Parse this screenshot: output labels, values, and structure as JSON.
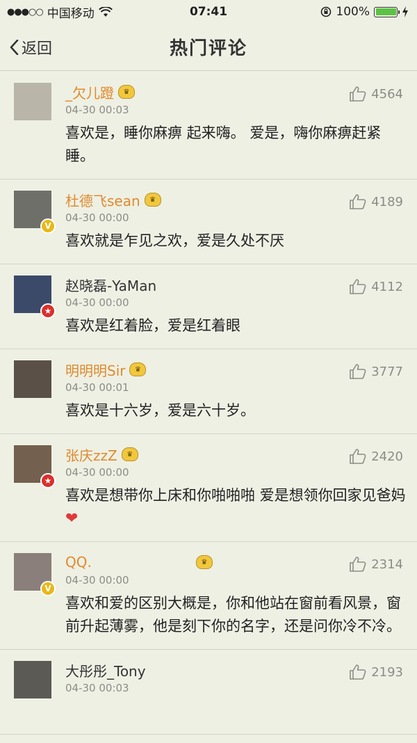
{
  "status_bar": {
    "carrier": "中国移动",
    "time": "07:41",
    "battery_percent": "100%",
    "battery_level": 1.0
  },
  "nav": {
    "back_label": "返回",
    "title": "热门评论"
  },
  "comments": [
    {
      "username": "_欠儿蹬",
      "time": "04-30 00:03",
      "text": "喜欢是，睡你麻痹 起来嗨。 爱是，嗨你麻痹赶紧睡。",
      "likes": "4564",
      "vip": true,
      "badge": ""
    },
    {
      "username": "杜德飞sean",
      "time": "04-30 00:00",
      "text": "喜欢就是乍见之欢，爱是久处不厌",
      "likes": "4189",
      "vip": true,
      "badge": "v"
    },
    {
      "username": "赵晓磊-YaMan",
      "time": "04-30 00:00",
      "text": "喜欢是红着脸，爱是红着眼",
      "likes": "4112",
      "vip": false,
      "badge": "star"
    },
    {
      "username": "明明明Sir",
      "time": "04-30 00:01",
      "text": "喜欢是十六岁，爱是六十岁。",
      "likes": "3777",
      "vip": true,
      "badge": ""
    },
    {
      "username": "张庆zzZ",
      "time": "04-30 00:00",
      "text": "喜欢是想带你上床和你啪啪啪 爱是想领你回家见爸妈",
      "likes": "2420",
      "vip": true,
      "badge": "star"
    },
    {
      "username": "QQ.",
      "time": "04-30 00:00",
      "text": "喜欢和爱的区别大概是，你和他站在窗前看风景，窗前升起薄雾，他是刻下你的名字，还是问你冷不冷。",
      "likes": "2314",
      "vip": true,
      "badge": "v"
    },
    {
      "username": "大彤彤_Tony",
      "time": "04-30 00:03",
      "text": "",
      "likes": "2193",
      "vip": false,
      "badge": ""
    }
  ],
  "colors": {
    "background": "#eef0e4",
    "username_accent": "#e08a2c",
    "battery_green": "#5cc245"
  },
  "icons": [
    "back-chevron-icon",
    "thumbs-up-icon",
    "vip-crown-icon",
    "heart-emoji-icon",
    "wifi-icon",
    "battery-icon"
  ]
}
